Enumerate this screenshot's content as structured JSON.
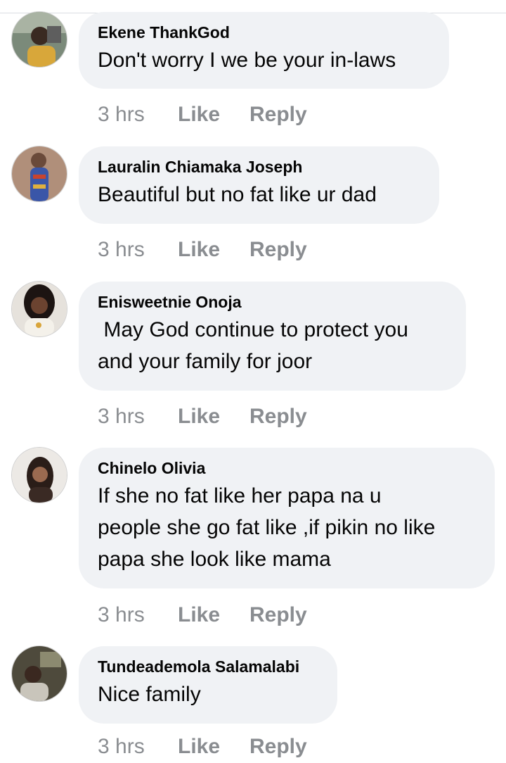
{
  "comments": [
    {
      "author": "Ekene ThankGod",
      "text": "Don't worry I we be your in-laws",
      "time": "3 hrs",
      "like_label": "Like",
      "reply_label": "Reply"
    },
    {
      "author": "Lauralin Chiamaka Joseph",
      "text": "Beautiful but no fat like ur dad",
      "time": "3 hrs",
      "like_label": "Like",
      "reply_label": "Reply"
    },
    {
      "author": "Enisweetnie Onoja",
      "text": " May God continue to protect you\nand your family for joor",
      "time": "3 hrs",
      "like_label": "Like",
      "reply_label": "Reply"
    },
    {
      "author": "Chinelo Olivia",
      "text": "If she no fat like her papa na u\npeople she go fat like ,if pikin no like\npapa she look like mama",
      "time": "3 hrs",
      "like_label": "Like",
      "reply_label": "Reply"
    },
    {
      "author": "Tundeademola Salamalabi",
      "text": "Nice family",
      "time": "3 hrs",
      "like_label": "Like",
      "reply_label": "Reply"
    }
  ],
  "colors": {
    "bubble": "#f0f2f5",
    "meta_text": "#8a8d91",
    "author_text": "#050505"
  }
}
